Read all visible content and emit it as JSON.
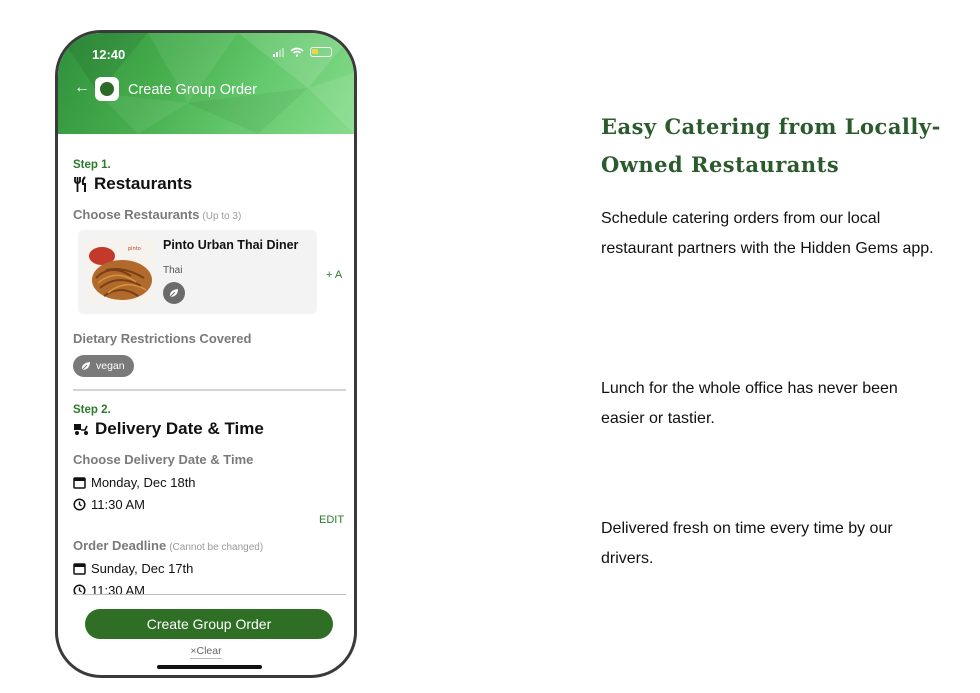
{
  "status_bar": {
    "time": "12:40"
  },
  "header": {
    "title": "Create Group Order"
  },
  "step1": {
    "label": "Step 1.",
    "title": "Restaurants",
    "choose_label": "Choose Restaurants",
    "choose_hint": "(Up to 3)",
    "restaurant": {
      "name": "Pinto Urban Thai Diner",
      "cuisine": "Thai"
    },
    "add_label": "+ A",
    "dietary_label": "Dietary Restrictions Covered",
    "dietary_chip": "vegan"
  },
  "step2": {
    "label": "Step 2.",
    "title": "Delivery Date & Time",
    "choose_label": "Choose Delivery Date & Time",
    "delivery_date": "Monday, Dec 18th",
    "delivery_time": "11:30 AM",
    "edit_label": "EDIT",
    "deadline_label": "Order Deadline",
    "deadline_hint": "(Cannot be changed)",
    "deadline_date": "Sunday, Dec 17th",
    "deadline_time": "11:30 AM"
  },
  "footer": {
    "primary_button": "Create Group Order",
    "clear_label": "Clear"
  },
  "marketing": {
    "headline": "Easy Catering from Locally-Owned Restaurants",
    "p1": "Schedule catering orders from our local restaurant partners with the Hidden Gems app.",
    "p2": "Lunch for the whole office has never been easier or tastier.",
    "p3": "Delivered fresh on time every time by our drivers."
  },
  "colors": {
    "brand_green": "#2e6f25",
    "accent_green": "#2c7a2a",
    "headline_green": "#2b5a2d"
  }
}
